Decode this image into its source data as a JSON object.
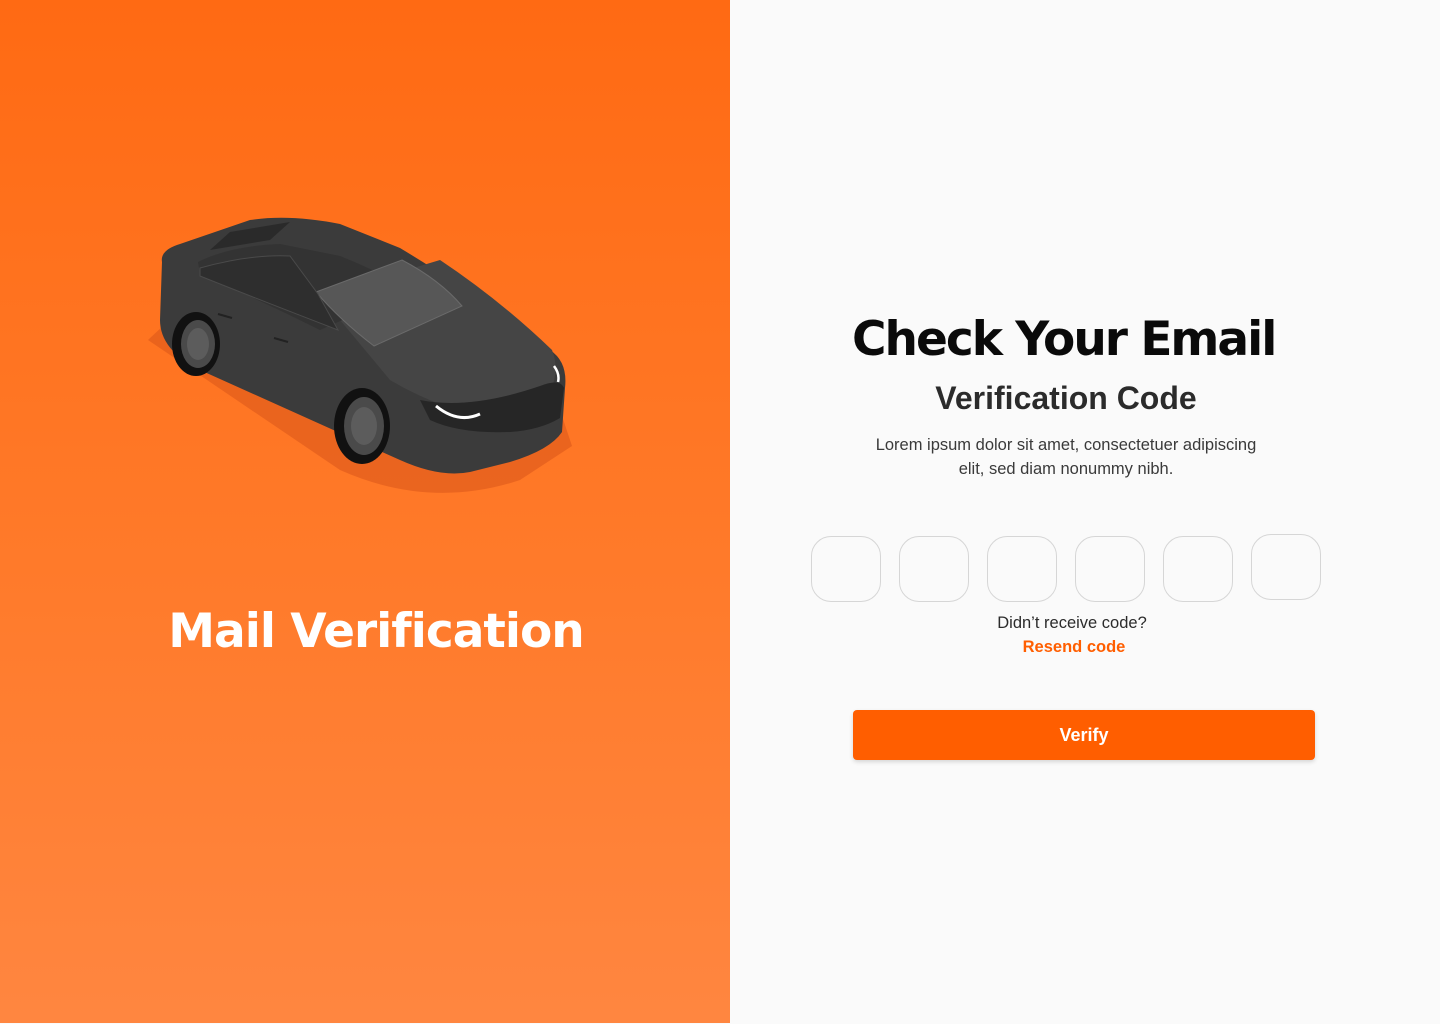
{
  "left_panel": {
    "title": "Mail Verification",
    "illustration_icon": "car-icon"
  },
  "right_panel": {
    "heading": "Check Your Email",
    "subheading": "Verification Code",
    "description": "Lorem ipsum dolor sit amet, consectetuer adipiscing elit, sed diam nonummy nibh.",
    "code_inputs": [
      {
        "value": ""
      },
      {
        "value": ""
      },
      {
        "value": ""
      },
      {
        "value": ""
      },
      {
        "value": ""
      },
      {
        "value": ""
      }
    ],
    "resend_question": "Didn’t receive code?",
    "resend_link": "Resend code",
    "verify_label": "Verify"
  },
  "colors": {
    "accent": "#ff5e00",
    "gradient_top": "#ff6a13",
    "gradient_bottom": "#ff8640",
    "background": "#fafafa"
  }
}
